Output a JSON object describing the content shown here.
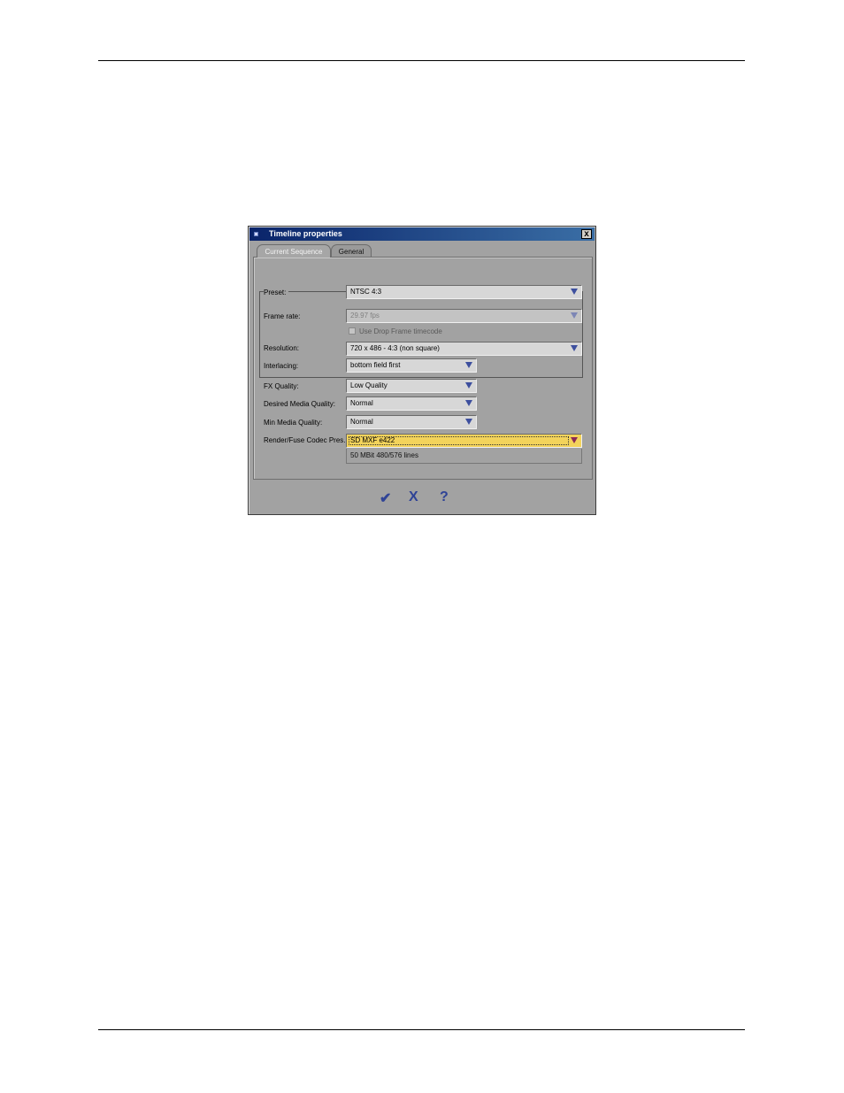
{
  "window": {
    "title": "Timeline properties",
    "close_glyph": "x"
  },
  "tabs": [
    {
      "label": "Current Sequence",
      "active": true
    },
    {
      "label": "General",
      "active": false
    }
  ],
  "fields": {
    "preset": {
      "label": "Preset:",
      "value": "NTSC  4:3"
    },
    "frame_rate": {
      "label": "Frame rate:",
      "value": "29.97 fps",
      "disabled": true
    },
    "drop_frame": {
      "label": "Use Drop Frame timecode",
      "checked": false,
      "disabled": true
    },
    "resolution": {
      "label": "Resolution:",
      "value": "720 x 486 - 4:3 (non square)"
    },
    "interlacing": {
      "label": "Interlacing:",
      "value": "bottom field first"
    },
    "fx_quality": {
      "label": "FX Quality:",
      "value": "Low Quality"
    },
    "desired_media_quality": {
      "label": "Desired Media Quality:",
      "value": "Normal"
    },
    "min_media_quality": {
      "label": "Min Media Quality:",
      "value": "Normal"
    },
    "render_codec": {
      "label": "Render/Fuse Codec Pres.",
      "value": "SD MXF e422",
      "description": "50 MBit 480/576 lines"
    }
  },
  "buttons": {
    "ok": "✔",
    "cancel": "X",
    "help": "?"
  },
  "icons": {
    "ok": "checkmark-icon",
    "cancel": "x-icon",
    "help": "question-icon",
    "dropdown": "triangle-down-icon"
  },
  "colors": {
    "dialog_bg": "#a2a2a2",
    "title_bar": "#0a246a",
    "highlight_field": "#f3d35b",
    "accent_icon": "#2f4396"
  }
}
